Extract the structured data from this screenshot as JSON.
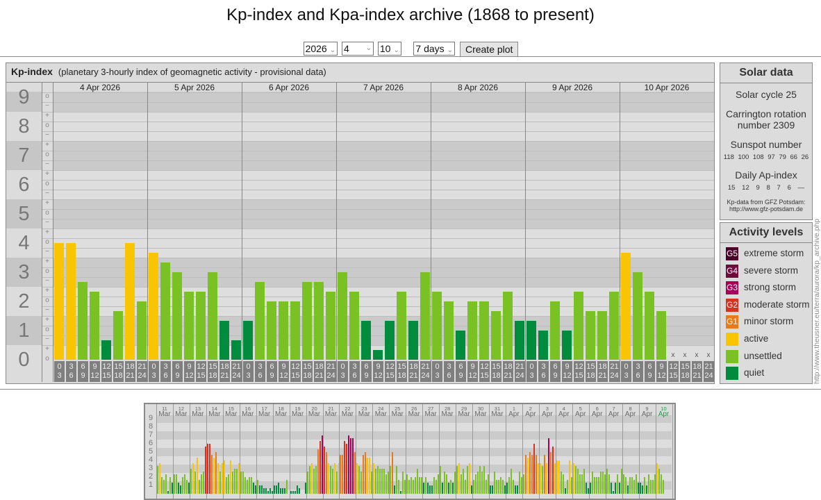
{
  "title": "Kp-index and Kpa-index archive (1868 to present)",
  "form": {
    "year": "2026",
    "month": "4",
    "day": "10",
    "span": "7 days",
    "create_label": "Create plot"
  },
  "kp_panel": {
    "title": "Kp-index",
    "subtitle": "(planetary 3-hourly index of geomagnetic activity - provisional data)"
  },
  "solar": {
    "title": "Solar data",
    "cycle": "Solar cycle 25",
    "carrington_1": "Carrington rotation",
    "carrington_2": "number 2309",
    "sunspot_label": "Sunspot number",
    "sunspots": [
      "118",
      "100",
      "108",
      "97",
      "79",
      "66",
      "26"
    ],
    "ap_label": "Daily Ap-index",
    "ap": [
      "15",
      "12",
      "9",
      "8",
      "7",
      "6",
      "—"
    ],
    "credit_1": "Kp-data from GFZ Potsdam:",
    "credit_2": "http://www.gfz-potsdam.de"
  },
  "activity": {
    "title": "Activity levels",
    "items": [
      {
        "badge": "G5",
        "label": "extreme storm",
        "color": "#4a0026"
      },
      {
        "badge": "G4",
        "label": "severe storm",
        "color": "#6e0a3c"
      },
      {
        "badge": "G3",
        "label": "strong storm",
        "color": "#a8005a"
      },
      {
        "badge": "G2",
        "label": "moderate storm",
        "color": "#d8321e"
      },
      {
        "badge": "G1",
        "label": "minor storm",
        "color": "#e97a17"
      },
      {
        "badge": "",
        "label": "active",
        "color": "#f8c500"
      },
      {
        "badge": "",
        "label": "unsettled",
        "color": "#7ac124"
      },
      {
        "badge": "",
        "label": "quiet",
        "color": "#008c3c"
      }
    ]
  },
  "side_url": "http://www.theusner.eu/terra/aurora/kp_archive.php",
  "chart_data": [
    {
      "type": "bar",
      "title": "Kp-index",
      "ylim": [
        0,
        9
      ],
      "y_ticks": [
        "0",
        "1",
        "2",
        "3",
        "4",
        "5",
        "6",
        "7",
        "8",
        "9"
      ],
      "minor_ticks": [
        "+",
        "o",
        "−"
      ],
      "categories": [
        "4 Apr 2026",
        "5 Apr 2026",
        "6 Apr 2026",
        "7 Apr 2026",
        "8 Apr 2026",
        "9 Apr 2026",
        "10 Apr 2026"
      ],
      "hours": [
        [
          "0",
          "3"
        ],
        [
          "3",
          "6"
        ],
        [
          "6",
          "9"
        ],
        [
          "9",
          "12"
        ],
        [
          "12",
          "15"
        ],
        [
          "15",
          "18"
        ],
        [
          "18",
          "21"
        ],
        [
          "21",
          "24"
        ]
      ],
      "missing_mark": "x",
      "series": [
        [
          4,
          4,
          2.67,
          2.33,
          0.67,
          1.67,
          4,
          2
        ],
        [
          3.67,
          3.33,
          3,
          2.33,
          2.33,
          3,
          1.33,
          0.67
        ],
        [
          1.33,
          2.67,
          2,
          2,
          2,
          2.67,
          2.67,
          2.33
        ],
        [
          3,
          2.33,
          1.33,
          0.33,
          1.33,
          2.33,
          1.33,
          3
        ],
        [
          2.33,
          2,
          1,
          2,
          2,
          1.67,
          2.33,
          1.33
        ],
        [
          1.33,
          1,
          2,
          1,
          2.33,
          1.67,
          1.67,
          2.33
        ],
        [
          3.67,
          3,
          2.33,
          1.67,
          null,
          null,
          null,
          null
        ]
      ]
    },
    {
      "type": "bar",
      "title": "Kp overview",
      "ylim": [
        0,
        9
      ],
      "y_ticks": [
        "1",
        "2",
        "3",
        "4",
        "5",
        "6",
        "7",
        "8",
        "9"
      ],
      "days": [
        [
          "11",
          "Mar"
        ],
        [
          "12",
          "Mar"
        ],
        [
          "13",
          "Mar"
        ],
        [
          "14",
          "Mar"
        ],
        [
          "15",
          "Mar"
        ],
        [
          "16",
          "Mar"
        ],
        [
          "17",
          "Mar"
        ],
        [
          "18",
          "Mar"
        ],
        [
          "19",
          "Mar"
        ],
        [
          "20",
          "Mar"
        ],
        [
          "21",
          "Mar"
        ],
        [
          "22",
          "Mar"
        ],
        [
          "23",
          "Mar"
        ],
        [
          "24",
          "Mar"
        ],
        [
          "25",
          "Mar"
        ],
        [
          "26",
          "Mar"
        ],
        [
          "27",
          "Mar"
        ],
        [
          "28",
          "Mar"
        ],
        [
          "29",
          "Mar"
        ],
        [
          "30",
          "Mar"
        ],
        [
          "31",
          "Mar"
        ],
        [
          "1",
          "Apr"
        ],
        [
          "2",
          "Apr"
        ],
        [
          "3",
          "Apr"
        ],
        [
          "4",
          "Apr"
        ],
        [
          "5",
          "Apr"
        ],
        [
          "6",
          "Apr"
        ],
        [
          "7",
          "Apr"
        ],
        [
          "8",
          "Apr"
        ],
        [
          "9",
          "Apr"
        ],
        [
          "10",
          "Apr"
        ]
      ],
      "series": [
        [
          3.33,
          3.67,
          2,
          1.67,
          2.33,
          0.33,
          2,
          1.33
        ],
        [
          2.33,
          2.33,
          1.33,
          1,
          2,
          2.33,
          1.67,
          1.33
        ],
        [
          3,
          3.67,
          2.67,
          4.33,
          1.67,
          2.33,
          2.67,
          5.67
        ],
        [
          6,
          6,
          4.67,
          4.33,
          5,
          3.67,
          2.67,
          3.67
        ],
        [
          4,
          2,
          2.33,
          4,
          2.67,
          3,
          3,
          3.67
        ],
        [
          2.67,
          2.67,
          2,
          1.67,
          2,
          2,
          1.33,
          1
        ],
        [
          1.67,
          1,
          1,
          0.67,
          0.67,
          0.33,
          0.67,
          0.33
        ],
        [
          1,
          1,
          1.33,
          0.67,
          0.67,
          0.67,
          1.67,
          0
        ],
        [
          0.33,
          0.33,
          0.33,
          1,
          0.67,
          0,
          0,
          1.33
        ],
        [
          2.67,
          3.33,
          3.67,
          3,
          3.33,
          5.33,
          6.33,
          7
        ],
        [
          5.67,
          5,
          3.67,
          3.33,
          3,
          3.67,
          2.67,
          3.67
        ],
        [
          4.67,
          4.67,
          6.33,
          6,
          7,
          6.67,
          6.67,
          5
        ],
        [
          3.67,
          3.33,
          2.67,
          4.67,
          5,
          4.33,
          4.33,
          2.67
        ],
        [
          3.67,
          3,
          3.33,
          3,
          3,
          3,
          2.33,
          2.67
        ],
        [
          3.33,
          5,
          1,
          3.33,
          1.67,
          0.33,
          2.67,
          1.67
        ],
        [
          2.33,
          1.67,
          2,
          1.67,
          2,
          3,
          2,
          2
        ],
        [
          1.33,
          2,
          1.33,
          1,
          1,
          2,
          1.67,
          2.33
        ],
        [
          3.33,
          1.33,
          2.67,
          2.33,
          1.33,
          1.67,
          1.33,
          2.67
        ],
        [
          3.33,
          3.67,
          2.33,
          3,
          1.67,
          3.33,
          3.67,
          1
        ],
        [
          1.67,
          2.33,
          2.67,
          3.33,
          2.67,
          3.33,
          1.67,
          2.33
        ],
        [
          1,
          1,
          2.67,
          1.67,
          1.67,
          2,
          1.67,
          1
        ],
        [
          1.33,
          2,
          3,
          1.67,
          1,
          1,
          2.67,
          2
        ],
        [
          2.33,
          4.67,
          4.33,
          5,
          4.67,
          6,
          4.67,
          3.67
        ],
        [
          3.67,
          3.33,
          4.67,
          3.67,
          6.67,
          5,
          5.67,
          3.67
        ],
        [
          4,
          4,
          2.67,
          2.33,
          0.67,
          1.67,
          4,
          2
        ],
        [
          3.67,
          3.33,
          3,
          2.33,
          2.33,
          3,
          1.33,
          0.67
        ],
        [
          1.33,
          2.67,
          2,
          2,
          2,
          2.67,
          2.67,
          2.33
        ],
        [
          3,
          2.33,
          1.33,
          0.33,
          1.33,
          2.33,
          1.33,
          3
        ],
        [
          2.33,
          2,
          1,
          2,
          2,
          1.67,
          2.33,
          1.33
        ],
        [
          1.33,
          1,
          2,
          1,
          2.33,
          1.67,
          1.67,
          2.33
        ],
        [
          3.67,
          3,
          2.33,
          1.67
        ]
      ],
      "highlight_color": "#1a9a4a"
    }
  ]
}
